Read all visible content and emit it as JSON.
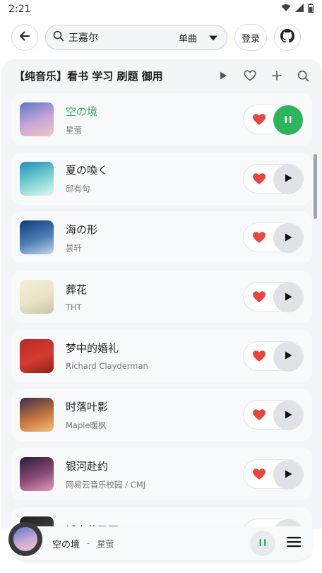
{
  "status": {
    "time": "2:21"
  },
  "header": {
    "search_value": "王嘉尔",
    "search_type": "单曲",
    "login_label": "登录"
  },
  "playlist": {
    "title": "【纯音乐】看书 学习 刷题 御用",
    "songs": [
      {
        "title": "空の境",
        "artist": "星萤",
        "playing": true,
        "colors": [
          "#5a78c8",
          "#c9a7d8",
          "#f1c6c1"
        ]
      },
      {
        "title": "夏の喚く",
        "artist": "邱有句",
        "playing": false,
        "colors": [
          "#1f8fc0",
          "#7fd3d2",
          "#e7f6f1"
        ]
      },
      {
        "title": "海の形",
        "artist": "昙轩",
        "playing": false,
        "colors": [
          "#0f3c7a",
          "#4d7fb6",
          "#c3d7ea"
        ]
      },
      {
        "title": "葬花",
        "artist": "THT",
        "playing": false,
        "colors": [
          "#f2efd8",
          "#e8e4c4",
          "#c8c7a4"
        ]
      },
      {
        "title": "梦中的婚礼",
        "artist": "Richard Clayderman",
        "playing": false,
        "colors": [
          "#b82a24",
          "#d63b31",
          "#8c1f1a"
        ]
      },
      {
        "title": "时落叶影",
        "artist": "Maple暖枫",
        "playing": false,
        "colors": [
          "#3a2e4c",
          "#c4743d",
          "#f3c17a"
        ]
      },
      {
        "title": "银河赴约",
        "artist": "网易云音乐校园 / CMJ",
        "playing": false,
        "colors": [
          "#2b1b38",
          "#8a4a78",
          "#e69ab7"
        ]
      },
      {
        "title": "城南花已开",
        "artist": "",
        "playing": false,
        "colors": [
          "#1c1c1c",
          "#444",
          "#888"
        ]
      }
    ]
  },
  "player": {
    "song": "空の境",
    "separator": "-",
    "artist": "星萤"
  },
  "colors": {
    "accent": "#2db55d",
    "heart": "#e8453c"
  }
}
